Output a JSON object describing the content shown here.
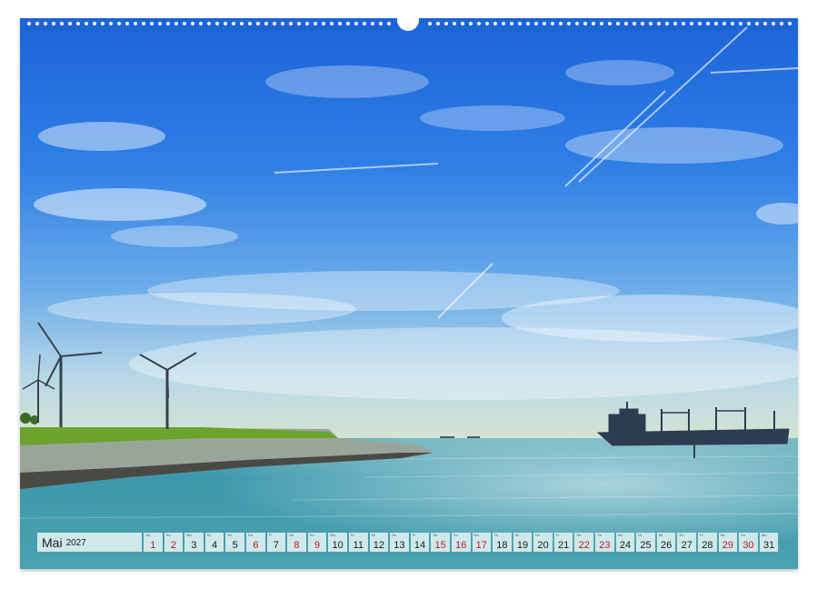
{
  "calendar": {
    "month": "Mai",
    "year": "2027",
    "days": [
      {
        "n": "1",
        "w": "Sa",
        "red": true
      },
      {
        "n": "2",
        "w": "So",
        "red": true
      },
      {
        "n": "3",
        "w": "Mo",
        "red": false
      },
      {
        "n": "4",
        "w": "Di",
        "red": false
      },
      {
        "n": "5",
        "w": "Mi",
        "red": false
      },
      {
        "n": "6",
        "w": "Do",
        "red": true
      },
      {
        "n": "7",
        "w": "Fr",
        "red": false
      },
      {
        "n": "8",
        "w": "Sa",
        "red": true
      },
      {
        "n": "9",
        "w": "So",
        "red": true
      },
      {
        "n": "10",
        "w": "Mo",
        "red": false
      },
      {
        "n": "11",
        "w": "Di",
        "red": false
      },
      {
        "n": "12",
        "w": "Mi",
        "red": false
      },
      {
        "n": "13",
        "w": "Do",
        "red": false
      },
      {
        "n": "14",
        "w": "Fr",
        "red": false
      },
      {
        "n": "15",
        "w": "Sa",
        "red": true
      },
      {
        "n": "16",
        "w": "So",
        "red": true
      },
      {
        "n": "17",
        "w": "Mo",
        "red": true
      },
      {
        "n": "18",
        "w": "Di",
        "red": false
      },
      {
        "n": "19",
        "w": "Mi",
        "red": false
      },
      {
        "n": "20",
        "w": "Do",
        "red": false
      },
      {
        "n": "21",
        "w": "Fr",
        "red": false
      },
      {
        "n": "22",
        "w": "Sa",
        "red": true
      },
      {
        "n": "23",
        "w": "So",
        "red": true
      },
      {
        "n": "24",
        "w": "Mo",
        "red": false
      },
      {
        "n": "25",
        "w": "Di",
        "red": false
      },
      {
        "n": "26",
        "w": "Mi",
        "red": false
      },
      {
        "n": "27",
        "w": "Do",
        "red": false
      },
      {
        "n": "28",
        "w": "Fr",
        "red": false
      },
      {
        "n": "29",
        "w": "Sa",
        "red": true
      },
      {
        "n": "30",
        "w": "So",
        "red": true
      },
      {
        "n": "31",
        "w": "Mo",
        "red": false
      }
    ]
  },
  "colors": {
    "sky_top": "#1f6ee0",
    "sky_mid": "#4a96ec",
    "sky_horizon": "#c8dcd8",
    "sea": "#3f9aaa",
    "grass": "#6ca32c",
    "calendar_cell": "#cfe9ea",
    "holiday_red": "#c0182a"
  }
}
